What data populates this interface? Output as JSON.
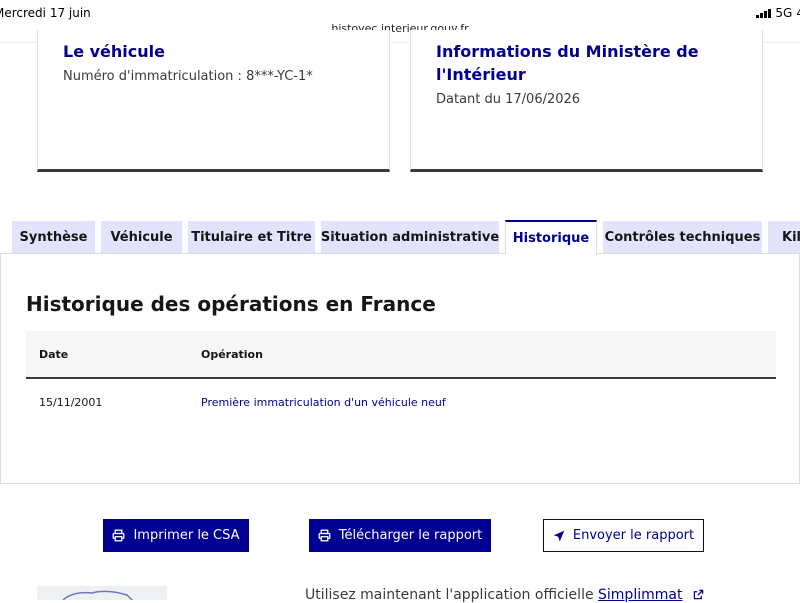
{
  "status_bar": {
    "time": "Mercredi 17 juin",
    "network": "5G",
    "battery": "4"
  },
  "browser": {
    "url": "histovec.interieur.gouv.fr"
  },
  "cards": {
    "vehicle": {
      "title": "Le véhicule",
      "description": "Numéro d'immatriculation : 8***-YC-1*"
    },
    "ministry": {
      "title": "Informations du Ministère de l'Intérieur",
      "description": "Datant du 17/06/2026"
    }
  },
  "tabs": [
    {
      "label": "Synthèse"
    },
    {
      "label": "Véhicule"
    },
    {
      "label": "Titulaire et Titre"
    },
    {
      "label": "Situation administrative"
    },
    {
      "label": "Historique",
      "active": true
    },
    {
      "label": "Contrôles techniques"
    },
    {
      "label": "Kil"
    }
  ],
  "history": {
    "title": "Historique des opérations en France",
    "columns": [
      "Date",
      "Opération"
    ],
    "rows": [
      {
        "date": "15/11/2001",
        "operation": "Première immatriculation d'un véhicule neuf"
      }
    ]
  },
  "actions": {
    "print": "Imprimer le CSA",
    "download": "Télécharger le rapport",
    "send": "Envoyer le rapport"
  },
  "footer_promo": {
    "text": "Utilisez maintenant l'application officielle ",
    "link": "Simplimmat"
  },
  "colors": {
    "primary": "#000091",
    "tab_bg": "#e3e3fd",
    "text": "#161616",
    "muted": "#3a3a3a"
  }
}
